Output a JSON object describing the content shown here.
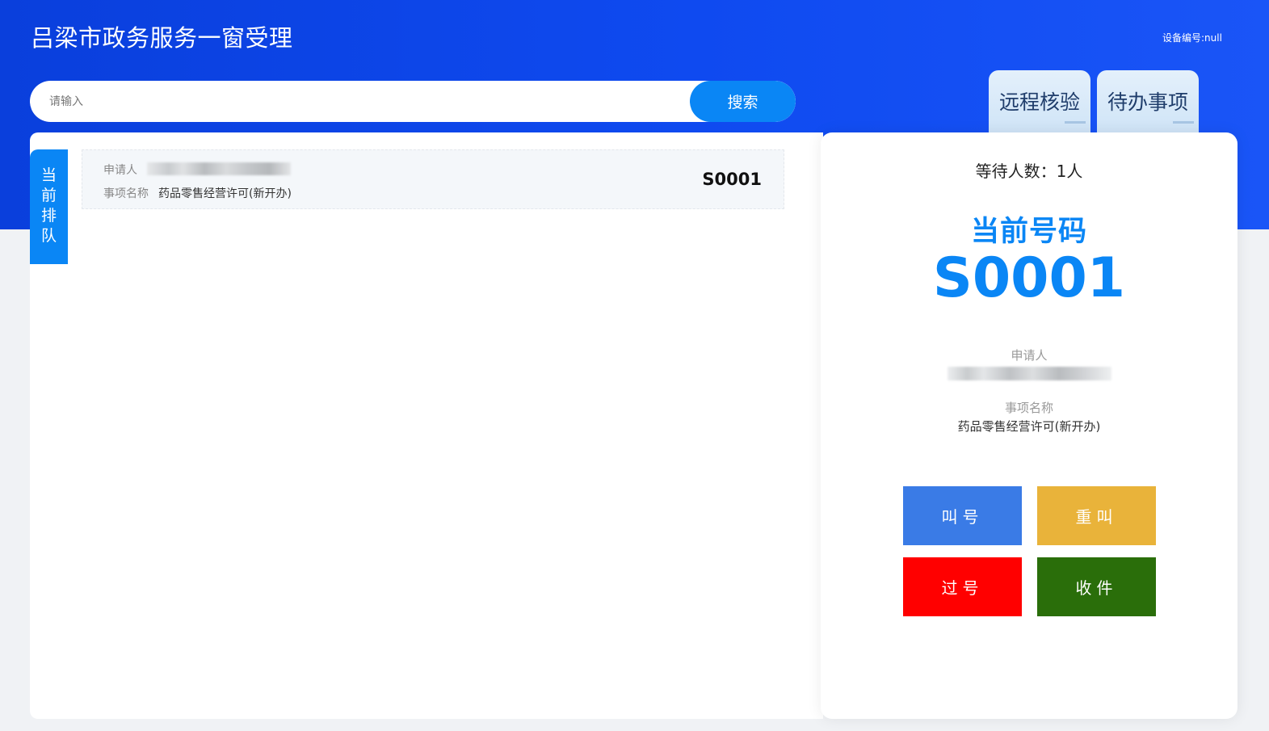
{
  "header": {
    "title": "吕梁市政务服务一窗受理",
    "device_no": "设备编号:null"
  },
  "search": {
    "placeholder": "请输入",
    "value": "",
    "button_label": "搜索"
  },
  "top_tabs": [
    {
      "label": "远程核验"
    },
    {
      "label": "待办事项"
    }
  ],
  "queue": {
    "tab_chars": [
      "当",
      "前",
      "排",
      "队"
    ],
    "items": [
      {
        "applicant_label": "申请人",
        "item_label": "事项名称",
        "item_value": "药品零售经营许可(新开办)",
        "number": "S0001"
      }
    ]
  },
  "current": {
    "waiting": "等待人数：1人",
    "label": "当前号码",
    "number": "S0001",
    "applicant_label": "申请人",
    "item_label": "事项名称",
    "item_value": "药品零售经营许可(新开办)"
  },
  "actions": {
    "call": "叫号",
    "recall": "重叫",
    "pass": "过号",
    "receive": "收件"
  },
  "colors": {
    "header_blue": "#0f4af0",
    "accent_blue": "#0a86f5",
    "call": "#3a7be6",
    "recall": "#e9b33a",
    "pass": "#ff0000",
    "receive": "#2a6e0a"
  }
}
